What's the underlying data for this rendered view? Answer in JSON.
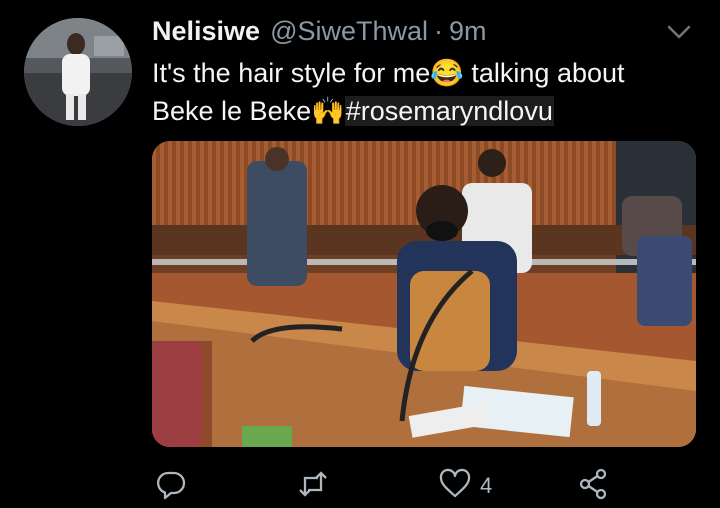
{
  "tweet": {
    "display_name": "Nelisiwe",
    "handle": "@SiweThwal",
    "separator": "·",
    "time": "9m",
    "text_part1": "It's the hair style for me",
    "emoji1": "😂",
    "text_part2": " talking about",
    "text_part3": "Beke le Beke",
    "emoji2": "🙌",
    "hashtag": "#rosemaryndlovu"
  },
  "actions": {
    "reply_count": "",
    "retweet_count": "",
    "like_count": "4",
    "share_count": ""
  },
  "icons": {
    "avatar": "avatar-photo",
    "menu": "chevron-down-icon",
    "reply": "reply-icon",
    "retweet": "retweet-icon",
    "like": "heart-icon",
    "share": "share-icon"
  },
  "colors": {
    "background": "#000000",
    "secondary_text": "#8b98a5",
    "icon": "#aeb6be",
    "hashtag_bg": "#1d1d1d"
  }
}
